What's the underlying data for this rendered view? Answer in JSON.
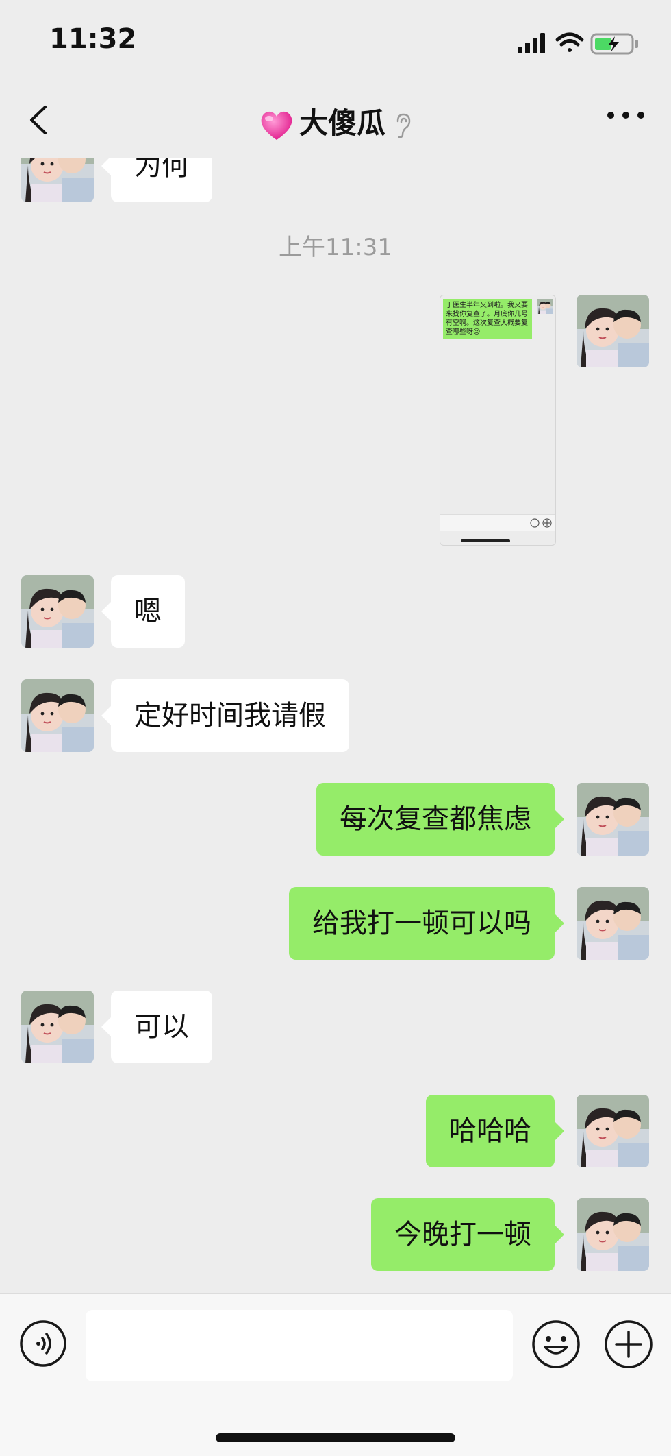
{
  "status_bar": {
    "time": "11:32"
  },
  "header": {
    "title": "大傻瓜"
  },
  "chat": {
    "partial_top_text": "为何",
    "timestamp": "上午11:31",
    "screenshot_message": {
      "inner_text": "丁医生半年又到啦。我又要来找你复查了。月底你几号有空啊。这次复查大概要复查哪些呀😉"
    },
    "messages": [
      {
        "side": "left",
        "text": "嗯"
      },
      {
        "side": "left",
        "text": "定好时间我请假"
      },
      {
        "side": "right",
        "text": "每次复查都焦虑"
      },
      {
        "side": "right",
        "text": "给我打一顿可以吗"
      },
      {
        "side": "left",
        "text": "可以"
      },
      {
        "side": "right",
        "text": "哈哈哈"
      },
      {
        "side": "right",
        "text": "今晚打一顿"
      }
    ]
  },
  "input_bar": {
    "placeholder": ""
  },
  "colors": {
    "sent_bubble": "#95ec69",
    "received_bubble": "#ffffff",
    "background": "#ededed"
  }
}
